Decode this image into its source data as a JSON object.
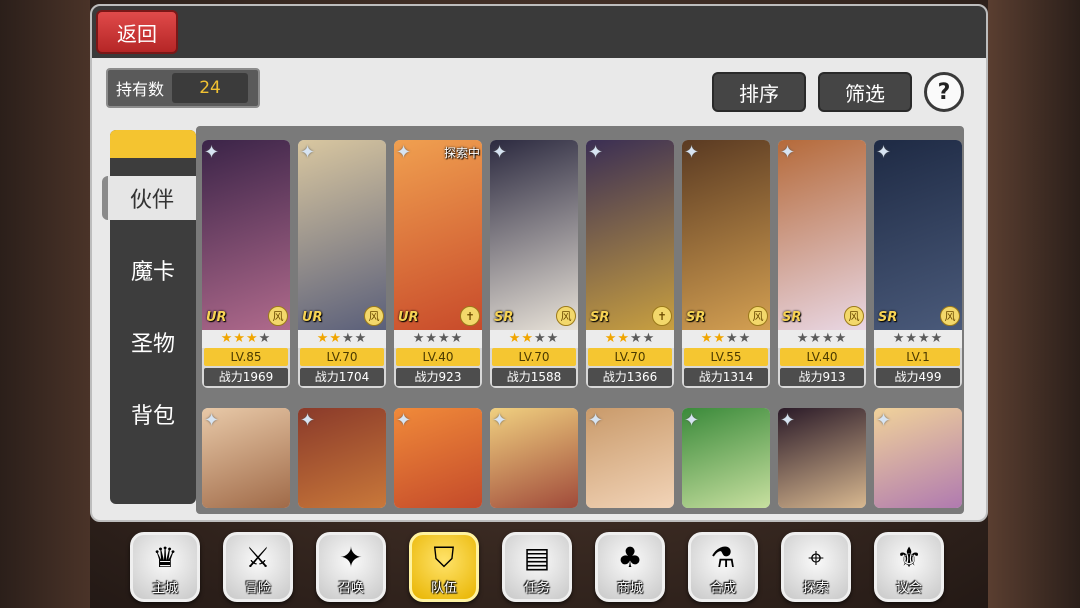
{
  "header": {
    "back_label": "返回"
  },
  "count": {
    "label": "持有数",
    "value": "24"
  },
  "toolbar": {
    "sort_label": "排序",
    "filter_label": "筛选",
    "help_label": "?"
  },
  "sidebar": {
    "items": [
      {
        "label": "伙伴",
        "active": true
      },
      {
        "label": "魔卡",
        "active": false
      },
      {
        "label": "圣物",
        "active": false
      },
      {
        "label": "背包",
        "active": false
      }
    ]
  },
  "cards_row1": [
    {
      "rarity": "UR",
      "stars": 3,
      "level": "LV.85",
      "power": "战力1969",
      "tag": "",
      "element": "风",
      "colors": [
        "#3b2448",
        "#b06a8c"
      ]
    },
    {
      "rarity": "UR",
      "stars": 2,
      "level": "LV.70",
      "power": "战力1704",
      "tag": "",
      "element": "风",
      "colors": [
        "#d9c7a0",
        "#5a5f7a"
      ]
    },
    {
      "rarity": "UR",
      "stars": 0,
      "level": "LV.40",
      "power": "战力923",
      "tag": "探索中",
      "element": "✝",
      "colors": [
        "#f0a050",
        "#c84a2a"
      ]
    },
    {
      "rarity": "SR",
      "stars": 2,
      "level": "LV.70",
      "power": "战力1588",
      "tag": "",
      "element": "风",
      "colors": [
        "#2c2a40",
        "#e8e2d8"
      ]
    },
    {
      "rarity": "SR",
      "stars": 2,
      "level": "LV.70",
      "power": "战力1366",
      "tag": "",
      "element": "✝",
      "colors": [
        "#3a2e54",
        "#c9a040"
      ]
    },
    {
      "rarity": "SR",
      "stars": 2,
      "level": "LV.55",
      "power": "战力1314",
      "tag": "",
      "element": "风",
      "colors": [
        "#5a3a22",
        "#d4a052"
      ]
    },
    {
      "rarity": "SR",
      "stars": 0,
      "level": "LV.40",
      "power": "战力913",
      "tag": "",
      "element": "风",
      "colors": [
        "#b56a3a",
        "#e9d7e4"
      ]
    },
    {
      "rarity": "SR",
      "stars": 0,
      "level": "LV.1",
      "power": "战力499",
      "tag": "",
      "element": "风",
      "colors": [
        "#1e2a44",
        "#4a5a7a"
      ]
    }
  ],
  "cards_row2": [
    {
      "colors": [
        "#e8c9a8",
        "#a06a48"
      ]
    },
    {
      "colors": [
        "#8a3a2a",
        "#c9783a"
      ]
    },
    {
      "colors": [
        "#f08a3a",
        "#c44a2a"
      ]
    },
    {
      "colors": [
        "#f0d080",
        "#a04a3a"
      ]
    },
    {
      "colors": [
        "#c99a6a",
        "#f2d4b8"
      ]
    },
    {
      "colors": [
        "#3a8a3a",
        "#c8e0a0"
      ]
    },
    {
      "colors": [
        "#2a1a28",
        "#d8b890"
      ]
    },
    {
      "colors": [
        "#f0d29a",
        "#b07ab0"
      ]
    }
  ],
  "nav": [
    {
      "label": "主城",
      "icon": "♛",
      "active": false
    },
    {
      "label": "冒险",
      "icon": "⚔",
      "active": false
    },
    {
      "label": "召唤",
      "icon": "✦",
      "active": false
    },
    {
      "label": "队伍",
      "icon": "⛉",
      "active": true
    },
    {
      "label": "任务",
      "icon": "▤",
      "active": false
    },
    {
      "label": "商城",
      "icon": "♣",
      "active": false
    },
    {
      "label": "合成",
      "icon": "⚗",
      "active": false
    },
    {
      "label": "探索",
      "icon": "⌖",
      "active": false
    },
    {
      "label": "议会",
      "icon": "⚜",
      "active": false
    }
  ]
}
